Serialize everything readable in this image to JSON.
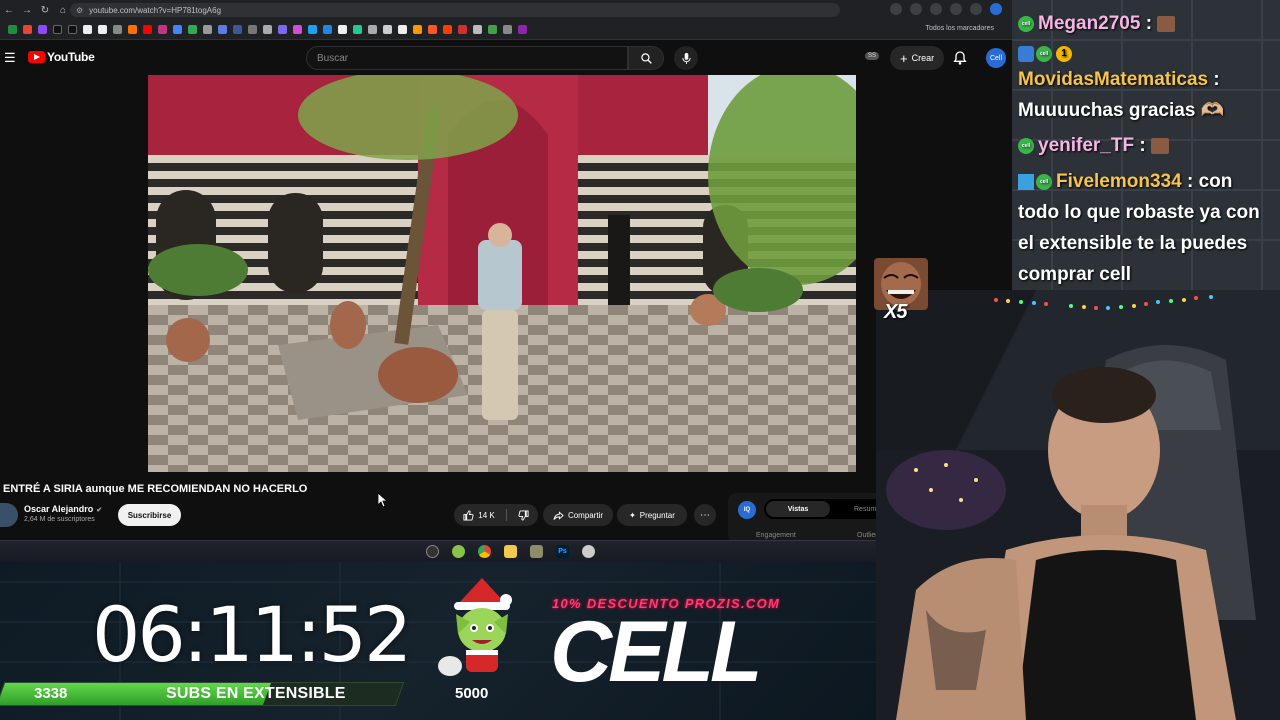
{
  "browser": {
    "url": "youtube.com/watch?v=HP781togA6g",
    "bookmarks_folder": "Todos los marcadores"
  },
  "youtube": {
    "logo_text": "YouTube",
    "search_placeholder": "Buscar",
    "badge": "SS",
    "create_label": "Crear",
    "avatar_text": "Cell"
  },
  "video": {
    "title": "ENTRÉ A SIRIA aunque ME RECOMIENDAN NO HACERLO",
    "channel": "Oscar Alejandro",
    "subscribers": "2,64 M de suscriptores",
    "subscribe_label": "Suscribirse",
    "likes": "14 K",
    "share_label": "Compartir",
    "ask_label": "Preguntar",
    "panel_icon": "IQ",
    "panel_tab_active": "Vistas",
    "panel_tab_other": "Resumen",
    "panel_metric_left": "Engagement",
    "panel_metric_right": "Outlier"
  },
  "overlay": {
    "timer": "06:11:52",
    "progress_current": "3338",
    "progress_label": "SUBS EN EXTENSIBLE",
    "progress_goal": "5000",
    "progress_fraction": 0.6676,
    "promo": "10% DESCUENTO PROZIS.COM",
    "brand": "CELL",
    "x5_label": "X5"
  },
  "chat": [
    {
      "user": "Megan2705",
      "color": "#f5b6e6",
      "message": "",
      "badges": [
        "bot"
      ],
      "emotes": 1
    },
    {
      "user": "MovidasMatematicas",
      "color": "#f7c44a",
      "message": "Muuuuchas gracias 🫶🏼",
      "badges": [
        "hammer",
        "bot",
        "1"
      ],
      "emotes": 0
    },
    {
      "user": "yenifer_TF",
      "color": "#f5b6e6",
      "message": "",
      "badges": [
        "bot"
      ],
      "emotes": 1
    },
    {
      "user": "Fivelemon334",
      "color": "#f7c44a",
      "message": "con todo lo que robaste ya con el extensible te la puedes comprar cell",
      "badges": [
        "cube",
        "bot"
      ],
      "emotes": 0
    }
  ],
  "colors": {
    "yt_red": "#ff0000",
    "progress_green": "#4ec43a",
    "promo_pink": "#ff3d6e"
  }
}
